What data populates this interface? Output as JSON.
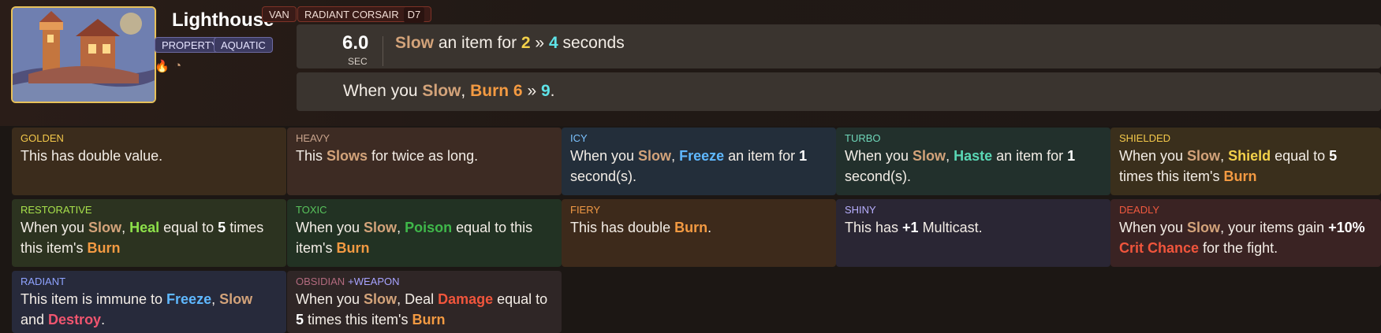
{
  "item": {
    "title": "Lighthouse",
    "hero_tag": "VAN",
    "set_tag": "RADIANT CORSAIR",
    "set_tier": "D7",
    "types": [
      "PROPERTY",
      "AQUATIC"
    ],
    "icons": [
      "flame-icon",
      "slow-clock-icon"
    ]
  },
  "cooldown": {
    "value": "6.0",
    "unit": "SEC"
  },
  "ability": {
    "w1": "Slow",
    "w2": " an item for ",
    "n1": "2",
    "w3": " » ",
    "n2": "4",
    "w4": " seconds"
  },
  "passive": {
    "w1": "When you ",
    "w2": "Slow",
    "w3": ", ",
    "w4": "Burn",
    "w5": " ",
    "n1": "6",
    "w6": " » ",
    "n2": "9",
    "w7": "."
  },
  "enchantments": {
    "golden": {
      "name": "GOLDEN",
      "t1": "This has double value."
    },
    "heavy": {
      "name": "HEAVY",
      "t1": "This ",
      "k1": "Slows",
      "t2": " for twice as long."
    },
    "icy": {
      "name": "ICY",
      "t1": "When you ",
      "k1": "Slow",
      "t2": ", ",
      "k2": "Freeze",
      "t3": " an item for ",
      "n1": "1",
      "t4": " second(s)."
    },
    "turbo": {
      "name": "TURBO",
      "t1": "When you ",
      "k1": "Slow",
      "t2": ", ",
      "k2": "Haste",
      "t3": " an item for ",
      "n1": "1",
      "t4": " second(s)."
    },
    "shielded": {
      "name": "SHIELDED",
      "t1": "When you ",
      "k1": "Slow",
      "t2": ", ",
      "k2": "Shield",
      "t3": " equal to ",
      "n1": "5",
      "t4": " times this item's ",
      "k3": "Burn"
    },
    "restorative": {
      "name": "RESTORATIVE",
      "t1": "When you ",
      "k1": "Slow",
      "t2": ", ",
      "k2": "Heal",
      "t3": " equal to ",
      "n1": "5",
      "t4": " times this item's ",
      "k3": "Burn"
    },
    "toxic": {
      "name": "TOXIC",
      "t1": "When you ",
      "k1": "Slow",
      "t2": ", ",
      "k2": "Poison",
      "t3": " equal to this item's ",
      "k3": "Burn"
    },
    "fiery": {
      "name": "FIERY",
      "t1": "This has double ",
      "k1": "Burn",
      "t2": "."
    },
    "shiny": {
      "name": "SHINY",
      "t1": "This has ",
      "n1": "+1",
      "t2": " Multicast."
    },
    "deadly": {
      "name": "DEADLY",
      "t1": "When you ",
      "k1": "Slow",
      "t2": ", your items gain ",
      "n1": "+10%",
      "t3": " ",
      "k2": "Crit Chance",
      "t4": " for the fight."
    },
    "radiant": {
      "name": "RADIANT",
      "t1": "This item is immune to ",
      "k1": "Freeze",
      "t2": ", ",
      "k2": "Slow",
      "t3": " and ",
      "k3": "Destroy",
      "t4": "."
    },
    "obsidian": {
      "name": "OBSIDIAN",
      "sub": "+WEAPON",
      "t1": "When you ",
      "k1": "Slow",
      "t2": ", Deal ",
      "k2": "Damage",
      "t3": " equal to ",
      "n1": "5",
      "t4": " times this item's ",
      "k3": "Burn"
    }
  }
}
